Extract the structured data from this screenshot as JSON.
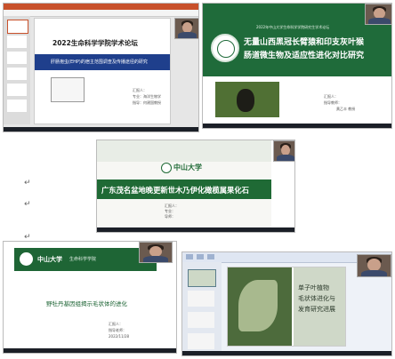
{
  "screenshot1": {
    "slide_title": "2022生命科学学院学术论坛",
    "banner_text": "肝肠孢虫(EHP)的宿主范围调查及传播途径的研究",
    "info": [
      "汇报人：",
      "专业：海洋生物学",
      "指导：何建国教授"
    ],
    "colors": {
      "bg": "#f1f1f1",
      "banner": "#1f3f8c"
    }
  },
  "screenshot2": {
    "top_line": "2022年中山大学生命科学学院研究生学术论坛",
    "title_line1": "无量山西黑冠长臂猿和印支灰叶猴",
    "title_line2": "肠道微生物及适应性进化对比研究",
    "info": [
      "汇报人：",
      "指导教师：",
      "黄乙丰 教授"
    ],
    "colors": {
      "green": "#1f6b3a"
    }
  },
  "screenshot3": {
    "logo_text": "中山大学",
    "title": "广东茂名盆地晚更新世木乃伊化橄榄属果化石",
    "info": [
      "汇报人：",
      "专业：",
      "导师："
    ],
    "colors": {
      "green": "#1f6a35"
    }
  },
  "screenshot4": {
    "logo_text": "中山大学",
    "logo_sub": "生命科学学院",
    "title": "野牡丹基因组揭示毛状体的进化",
    "info": [
      "汇报人：",
      "指导老师：",
      "2022/11/28"
    ],
    "colors": {
      "green": "#1e6535"
    }
  },
  "screenshot5": {
    "title_lines": [
      "单子叶植物",
      "毛状体进化与",
      "发育研究进展"
    ],
    "colors": {
      "toolbar": "#dfe6f2"
    }
  },
  "paragraph_marks": [
    "↵",
    "↵",
    "↵"
  ]
}
